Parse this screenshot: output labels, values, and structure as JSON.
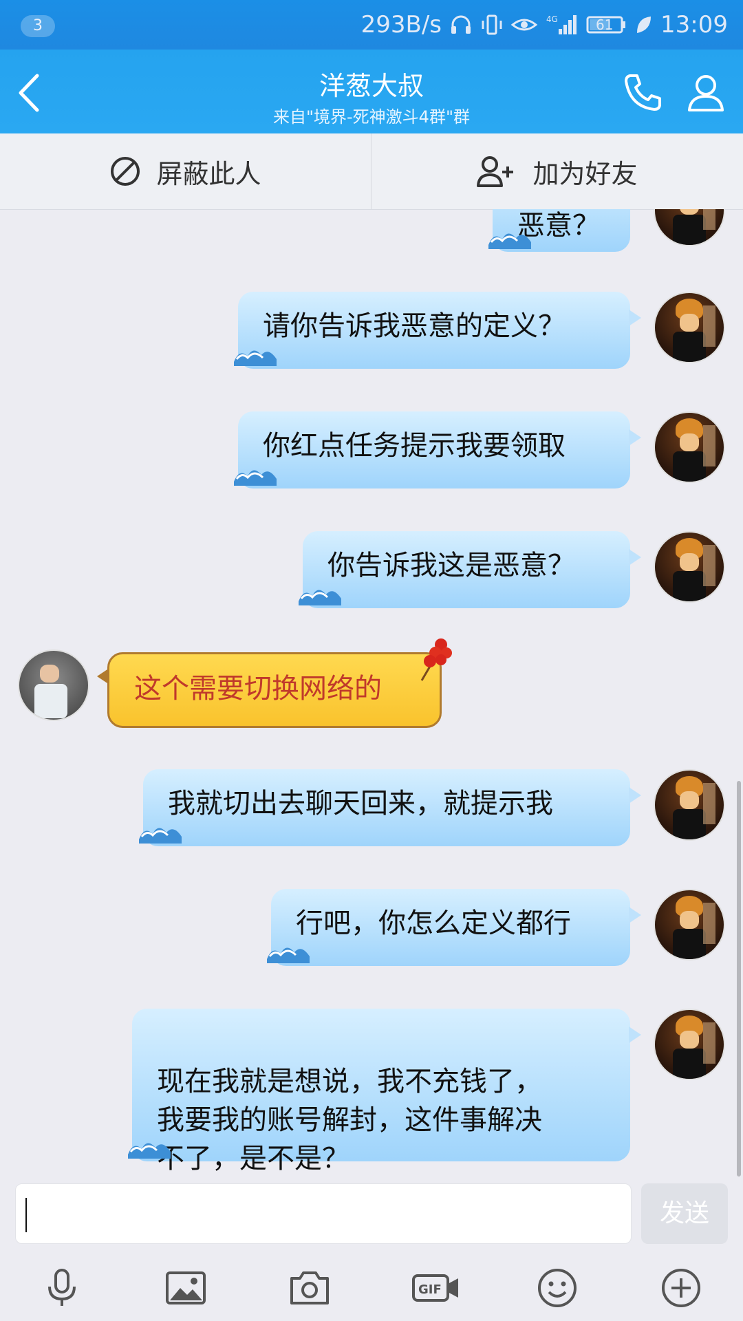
{
  "status_bar": {
    "notification_count": "3",
    "net_speed": "293B/s",
    "battery": "61",
    "time": "13:09"
  },
  "header": {
    "title": "洋葱大叔",
    "subtitle": "来自\"境界-死神激斗4群\"群"
  },
  "actions": {
    "block_label": "屏蔽此人",
    "add_friend_label": "加为好友"
  },
  "messages": [
    {
      "side": "right",
      "text": "恶意？"
    },
    {
      "side": "right",
      "text": "请你告诉我恶意的定义？"
    },
    {
      "side": "right",
      "text": "你红点任务提示我要领取"
    },
    {
      "side": "right",
      "text": "你告诉我这是恶意？"
    },
    {
      "side": "left",
      "text": "这个需要切换网络的"
    },
    {
      "side": "right",
      "text": "我就切出去聊天回来，就提示我"
    },
    {
      "side": "right",
      "text": "行吧，你怎么定义都行"
    },
    {
      "side": "right",
      "text": "现在我就是想说，我不充钱了，\n我要我的账号解封，这件事解决\n不了，是不是？"
    }
  ],
  "input": {
    "value": "",
    "send_label": "发送"
  },
  "toolbar": {
    "items": [
      "mic-icon",
      "image-icon",
      "camera-icon",
      "gif-icon",
      "emoji-icon",
      "plus-icon"
    ]
  },
  "colors": {
    "header_blue": "#25a3ef",
    "bubble_blue": "#bfe2fc",
    "bubble_yellow": "#f9c32d",
    "left_text_red": "#c0392b"
  }
}
